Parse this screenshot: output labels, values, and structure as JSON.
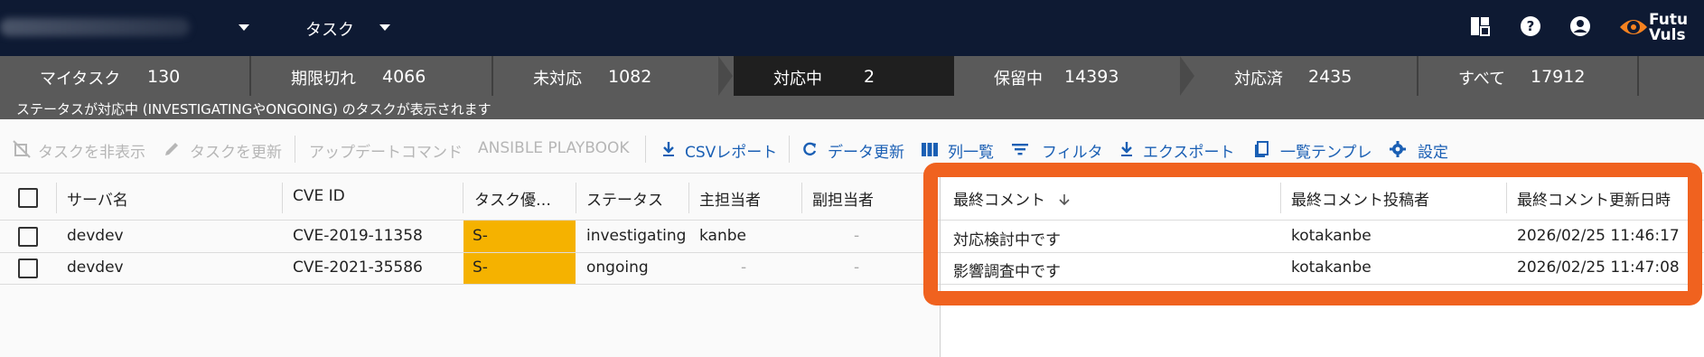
{
  "header": {
    "title": "タスク",
    "logo_text_line1": "Futu",
    "logo_text_line2": "Vuls"
  },
  "status_tabs": [
    {
      "label": "マイタスク",
      "count": "130"
    },
    {
      "label": "期限切れ",
      "count": "4066"
    },
    {
      "label": "未対応",
      "count": "1082"
    },
    {
      "label": "対応中",
      "count": "2"
    },
    {
      "label": "保留中",
      "count": "14393"
    },
    {
      "label": "対応済",
      "count": "2435"
    },
    {
      "label": "すべて",
      "count": "17912"
    }
  ],
  "info_text": "ステータスが対応中 (INVESTIGATINGやONGOING) のタスクが表示されます",
  "toolbar": {
    "hide": "タスクを非表示",
    "update": "タスクを更新",
    "update_cmd": "アップデートコマンド",
    "ansible": "ANSIBLE PLAYBOOK",
    "csv": "CSVレポート",
    "refresh": "データ更新",
    "columns": "列一覧",
    "filter": "フィルタ",
    "export": "エクスポート",
    "template": "一覧テンプレ",
    "settings": "設定"
  },
  "columns": {
    "server": "サーバ名",
    "cve": "CVE ID",
    "priority": "タスク優…",
    "status": "ステータス",
    "main": "主担当者",
    "sub": "副担当者",
    "last_comment": "最終コメント",
    "last_poster": "最終コメント投稿者",
    "last_updated": "最終コメント更新日時"
  },
  "rows": [
    {
      "server": "devdev",
      "cve": "CVE-2019-11358",
      "priority": "S-",
      "status": "investigating",
      "main": "kanbe",
      "sub": "-",
      "comment": "対応検討中です",
      "poster": "kotakanbe",
      "updated": "2026/02/25 11:46:17"
    },
    {
      "server": "devdev",
      "cve": "CVE-2021-35586",
      "priority": "S-",
      "status": "ongoing",
      "main": "-",
      "sub": "-",
      "comment": "影響調査中です",
      "poster": "kotakanbe",
      "updated": "2026/02/25 11:47:08"
    }
  ],
  "colors": {
    "topbar": "#0e1a33",
    "statusbar": "#5a5a5a",
    "active_tab": "#1f1f1f",
    "action_blue": "#1a5fb4",
    "priority_orange": "#f5b200",
    "highlight": "#f0621f"
  }
}
